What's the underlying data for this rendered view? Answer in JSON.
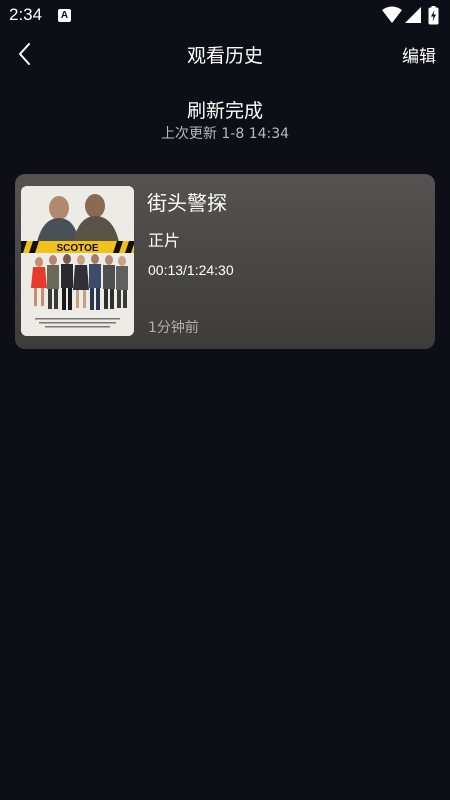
{
  "status_bar": {
    "time": "2:34",
    "notification_icon_letter": "A",
    "icons": [
      "wifi-icon",
      "signal-icon",
      "battery-icon"
    ]
  },
  "header": {
    "back_icon": "chevron-left-icon",
    "title": "观看历史",
    "edit_label": "编辑"
  },
  "refresh": {
    "title": "刷新完成",
    "subtitle": "上次更新 1-8 14:34"
  },
  "history": [
    {
      "title": "街头警探",
      "type": "正片",
      "progress": "00:13/1:24:30",
      "watched_ago": "1分钟前",
      "poster_text": "SCOTOE"
    }
  ],
  "colors": {
    "background": "#0d0e16",
    "card_top": "#545351",
    "card_bottom": "#3d3c3a",
    "muted_text": "#b0afac"
  }
}
